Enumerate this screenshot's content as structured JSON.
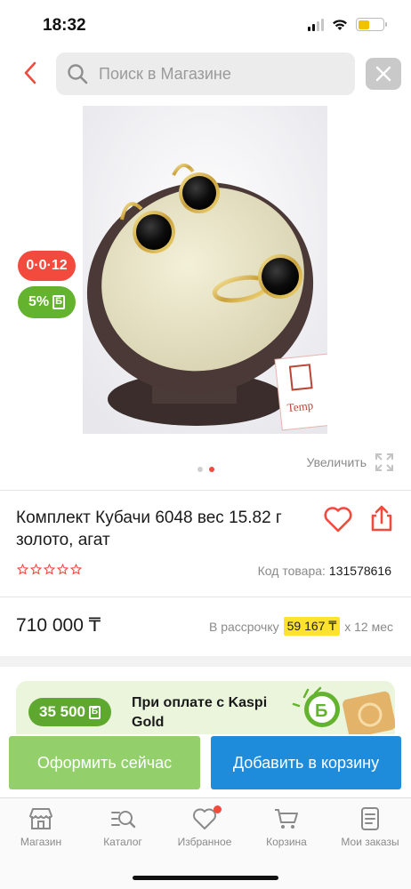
{
  "status_bar": {
    "time": "18:32"
  },
  "search": {
    "placeholder": "Поиск в Магазине"
  },
  "badges": {
    "installment": "0·0·12",
    "bonus": "5%"
  },
  "gallery": {
    "zoom_label": "Увеличить",
    "dots": 2,
    "active_dot": 2
  },
  "product": {
    "title": "Комплект Кубачи 6048 вес 15.82 г золото, агат",
    "sku_label": "Код товара:",
    "sku_value": "131578616",
    "rating": 0,
    "price": "710 000 ₸",
    "installment_label": "В рассрочку",
    "installment_amount": "59 167 ₸",
    "installment_term": "х 12 мес"
  },
  "kaspi_banner": {
    "bonus": "35 500",
    "text": "При оплате с Kaspi Gold"
  },
  "actions": {
    "checkout": "Оформить сейчас",
    "add_to_cart": "Добавить в корзину"
  },
  "tab_bar": {
    "items": [
      {
        "label": "Магазин",
        "icon": "store-icon"
      },
      {
        "label": "Каталог",
        "icon": "catalog-search-icon"
      },
      {
        "label": "Избранное",
        "icon": "heart-icon"
      },
      {
        "label": "Корзина",
        "icon": "cart-icon"
      },
      {
        "label": "Мои заказы",
        "icon": "orders-icon"
      }
    ]
  },
  "colors": {
    "accent_red": "#f24a3c",
    "green": "#63b32e",
    "blue": "#1f8bdb",
    "light_green": "#93d06b",
    "yellow": "#ffe22e"
  }
}
